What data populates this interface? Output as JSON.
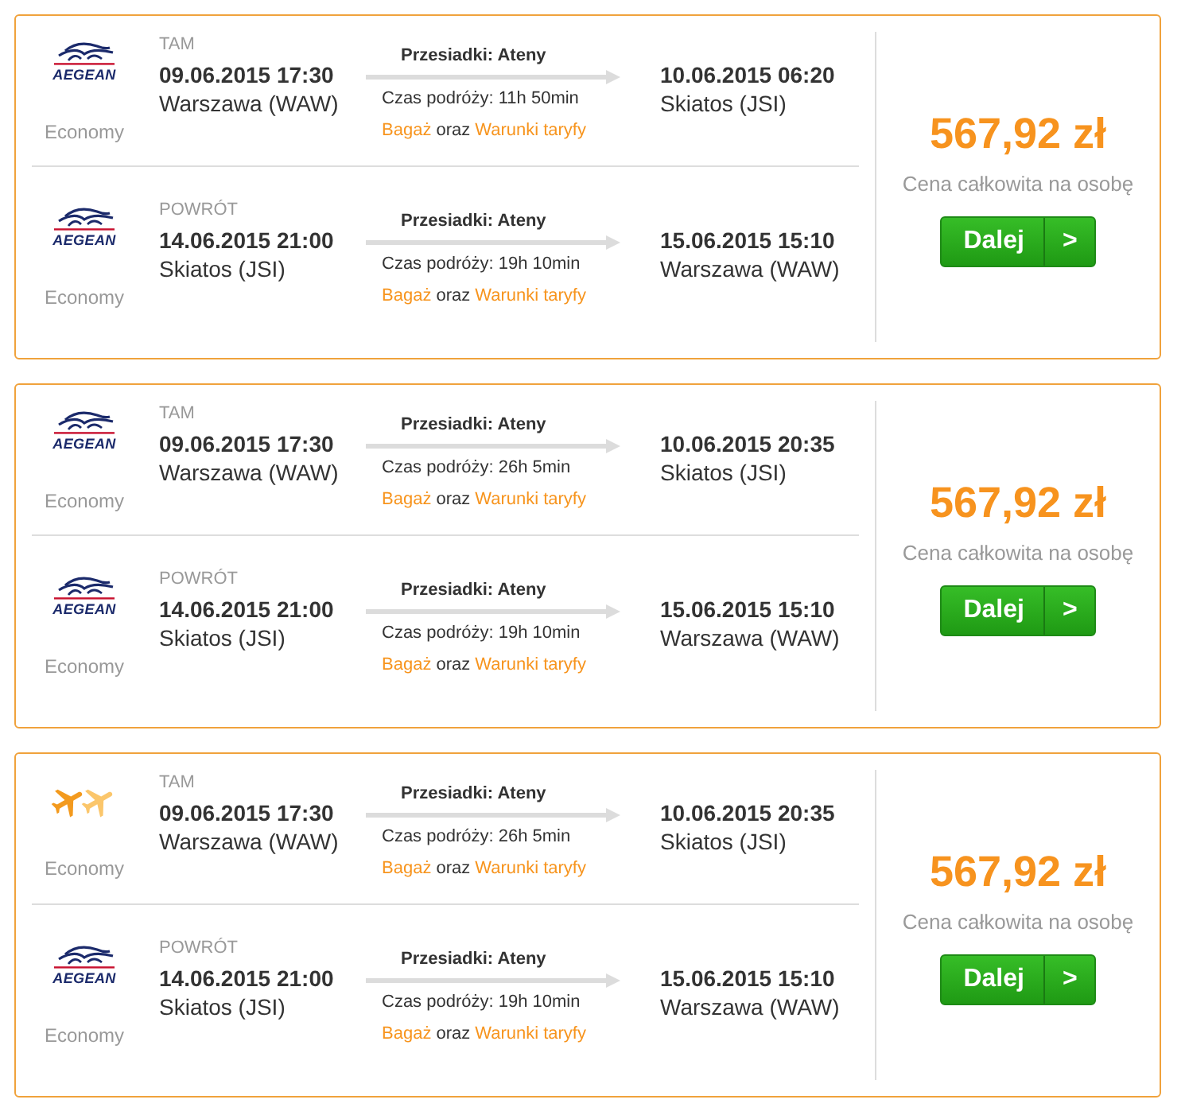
{
  "offers": [
    {
      "legs": [
        {
          "direction": "TAM",
          "airline": {
            "kind": "brand",
            "name": "AEGEAN"
          },
          "cabin": "Economy",
          "departure": {
            "datetime": "09.06.2015 17:30",
            "place": "Warszawa (WAW)"
          },
          "stops": "Przesiadki: Ateny",
          "duration": "Czas podróży: 11h 50min",
          "baggage_link": "Bagaż",
          "conjunction": "oraz",
          "fare_rules_link": "Warunki taryfy",
          "arrival": {
            "datetime": "10.06.2015 06:20",
            "place": "Skiatos (JSI)"
          }
        },
        {
          "direction": "POWRÓT",
          "airline": {
            "kind": "brand",
            "name": "AEGEAN"
          },
          "cabin": "Economy",
          "departure": {
            "datetime": "14.06.2015 21:00",
            "place": "Skiatos (JSI)"
          },
          "stops": "Przesiadki: Ateny",
          "duration": "Czas podróży: 19h 10min",
          "baggage_link": "Bagaż",
          "conjunction": "oraz",
          "fare_rules_link": "Warunki taryfy",
          "arrival": {
            "datetime": "15.06.2015 15:10",
            "place": "Warszawa (WAW)"
          }
        }
      ],
      "price": "567,92 zł",
      "price_note": "Cena całkowita na osobę",
      "button": {
        "label": "Dalej",
        "arrow": ">"
      }
    },
    {
      "legs": [
        {
          "direction": "TAM",
          "airline": {
            "kind": "brand",
            "name": "AEGEAN"
          },
          "cabin": "Economy",
          "departure": {
            "datetime": "09.06.2015 17:30",
            "place": "Warszawa (WAW)"
          },
          "stops": "Przesiadki: Ateny",
          "duration": "Czas podróży: 26h 5min",
          "baggage_link": "Bagaż",
          "conjunction": "oraz",
          "fare_rules_link": "Warunki taryfy",
          "arrival": {
            "datetime": "10.06.2015 20:35",
            "place": "Skiatos (JSI)"
          }
        },
        {
          "direction": "POWRÓT",
          "airline": {
            "kind": "brand",
            "name": "AEGEAN"
          },
          "cabin": "Economy",
          "departure": {
            "datetime": "14.06.2015 21:00",
            "place": "Skiatos (JSI)"
          },
          "stops": "Przesiadki: Ateny",
          "duration": "Czas podróży: 19h 10min",
          "baggage_link": "Bagaż",
          "conjunction": "oraz",
          "fare_rules_link": "Warunki taryfy",
          "arrival": {
            "datetime": "15.06.2015 15:10",
            "place": "Warszawa (WAW)"
          }
        }
      ],
      "price": "567,92 zł",
      "price_note": "Cena całkowita na osobę",
      "button": {
        "label": "Dalej",
        "arrow": ">"
      }
    },
    {
      "legs": [
        {
          "direction": "TAM",
          "airline": {
            "kind": "generic"
          },
          "cabin": "Economy",
          "departure": {
            "datetime": "09.06.2015 17:30",
            "place": "Warszawa (WAW)"
          },
          "stops": "Przesiadki: Ateny",
          "duration": "Czas podróży: 26h 5min",
          "baggage_link": "Bagaż",
          "conjunction": "oraz",
          "fare_rules_link": "Warunki taryfy",
          "arrival": {
            "datetime": "10.06.2015 20:35",
            "place": "Skiatos (JSI)"
          }
        },
        {
          "direction": "POWRÓT",
          "airline": {
            "kind": "brand",
            "name": "AEGEAN"
          },
          "cabin": "Economy",
          "departure": {
            "datetime": "14.06.2015 21:00",
            "place": "Skiatos (JSI)"
          },
          "stops": "Przesiadki: Ateny",
          "duration": "Czas podróży: 19h 10min",
          "baggage_link": "Bagaż",
          "conjunction": "oraz",
          "fare_rules_link": "Warunki taryfy",
          "arrival": {
            "datetime": "15.06.2015 15:10",
            "place": "Warszawa (WAW)"
          }
        }
      ],
      "price": "567,92 zł",
      "price_note": "Cena całkowita na osobę",
      "button": {
        "label": "Dalej",
        "arrow": ">"
      }
    }
  ]
}
